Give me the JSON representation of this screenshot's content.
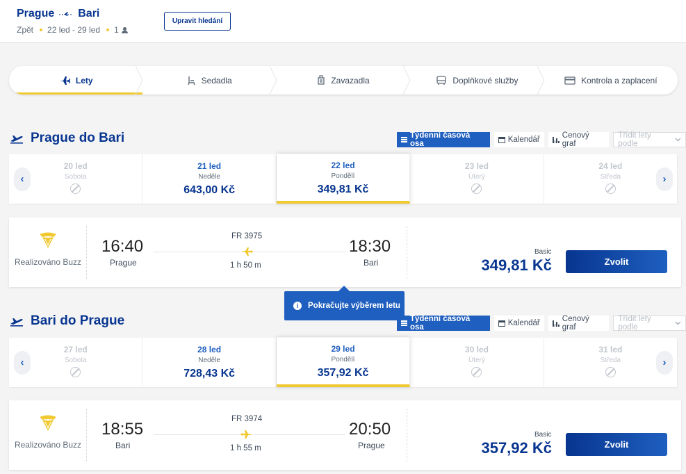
{
  "header": {
    "origin": "Prague",
    "destination": "Bari",
    "trip_type": "Zpět",
    "dates": "22 led - 29 led",
    "passengers": "1",
    "edit_label": "Upravit hledání"
  },
  "steps": [
    {
      "label": "Lety",
      "icon": "plane-icon",
      "active": true
    },
    {
      "label": "Sedadla",
      "icon": "seat-icon",
      "active": false
    },
    {
      "label": "Zavazadla",
      "icon": "luggage-icon",
      "active": false
    },
    {
      "label": "Doplňkové služby",
      "icon": "bus-icon",
      "active": false
    },
    {
      "label": "Kontrola a zaplacení",
      "icon": "card-icon",
      "active": false
    }
  ],
  "view": {
    "weekly": "Týdenní časová osa",
    "calendar": "Kalendář",
    "price_chart": "Cenový graf",
    "sort_placeholder": "Třídit lety podle"
  },
  "tooltip": "Pokračujte výběrem letu",
  "outbound": {
    "title": "Prague do Bari",
    "dates": [
      {
        "date": "20 led",
        "day": "Sobota",
        "price": "",
        "available": false,
        "selected": false
      },
      {
        "date": "21 led",
        "day": "Neděle",
        "price": "643,00 Kč",
        "available": true,
        "selected": false
      },
      {
        "date": "22 led",
        "day": "Pondělí",
        "price": "349,81 Kč",
        "available": true,
        "selected": true
      },
      {
        "date": "23 led",
        "day": "Úterý",
        "price": "",
        "available": false,
        "selected": false
      },
      {
        "date": "24 led",
        "day": "Středa",
        "price": "",
        "available": false,
        "selected": false
      }
    ],
    "flight": {
      "operator": "Realizováno Buzz",
      "dep_time": "16:40",
      "dep_city": "Prague",
      "flight_no": "FR 3975",
      "duration": "1 h 50 m",
      "arr_time": "18:30",
      "arr_city": "Bari",
      "fare": "Basic",
      "price": "349,81 Kč",
      "choose": "Zvolit"
    }
  },
  "inbound": {
    "title": "Bari do Prague",
    "dates": [
      {
        "date": "27 led",
        "day": "Sobota",
        "price": "",
        "available": false,
        "selected": false
      },
      {
        "date": "28 led",
        "day": "Neděle",
        "price": "728,43 Kč",
        "available": true,
        "selected": false
      },
      {
        "date": "29 led",
        "day": "Pondělí",
        "price": "357,92 Kč",
        "available": true,
        "selected": true
      },
      {
        "date": "30 led",
        "day": "Úterý",
        "price": "",
        "available": false,
        "selected": false
      },
      {
        "date": "31 led",
        "day": "Středa",
        "price": "",
        "available": false,
        "selected": false
      }
    ],
    "flight": {
      "operator": "Realizováno Buzz",
      "dep_time": "18:55",
      "dep_city": "Bari",
      "flight_no": "FR 3974",
      "duration": "1 h 55 m",
      "arr_time": "20:50",
      "arr_city": "Prague",
      "fare": "Basic",
      "price": "357,92 Kč",
      "choose": "Zvolit"
    }
  },
  "colors": {
    "brand_blue": "#073590",
    "accent_blue": "#1f5fbf",
    "accent_yellow": "#f1c933"
  }
}
